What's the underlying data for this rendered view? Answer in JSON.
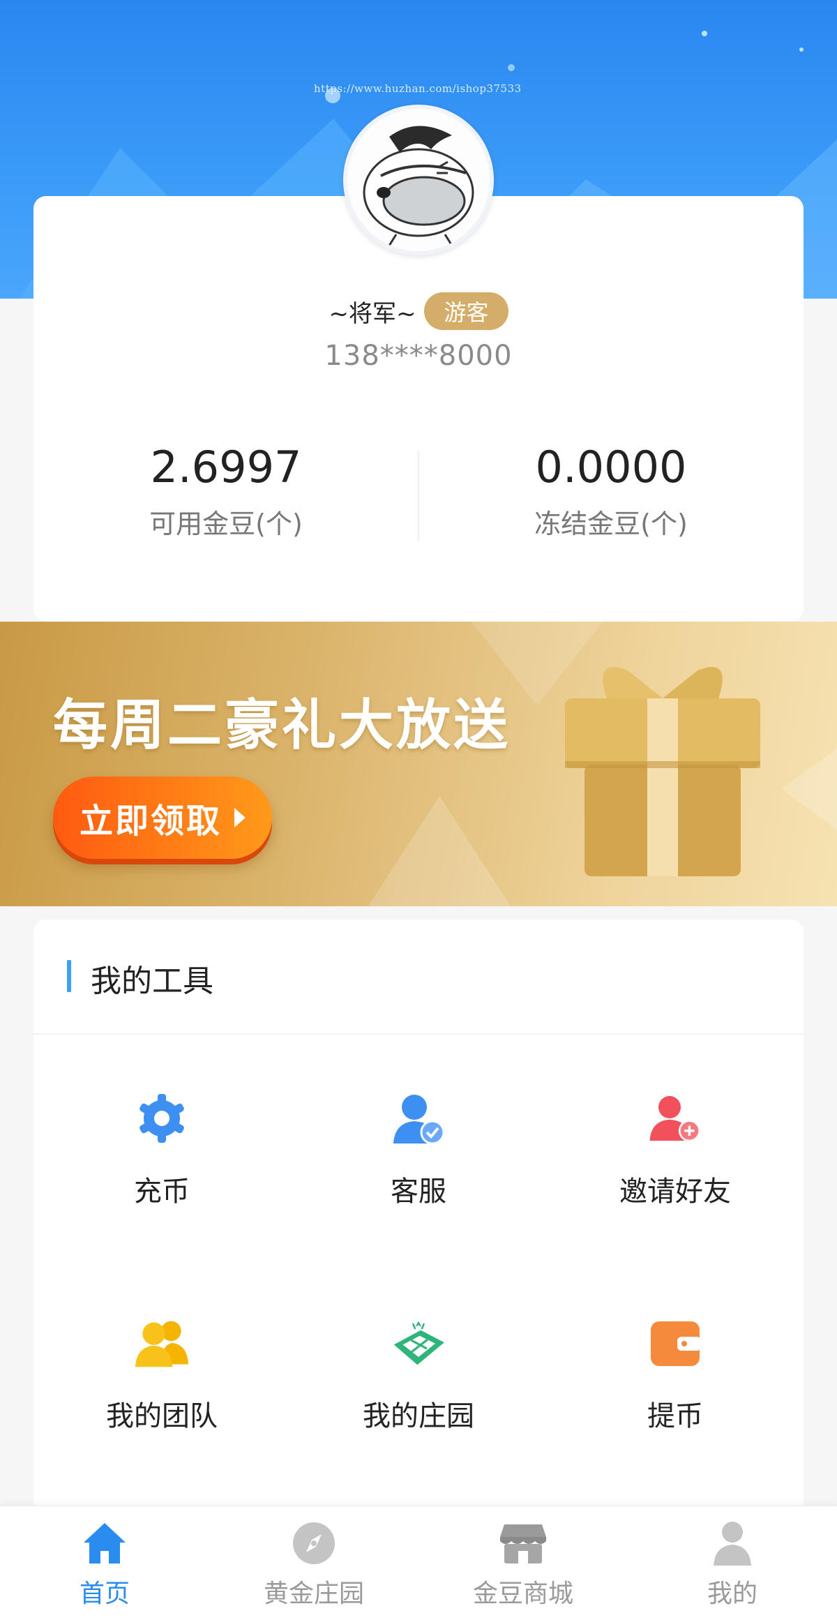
{
  "hero": {
    "url_watermark": "https://www.huzhan.com/ishop37533"
  },
  "profile": {
    "nickname": "~将军~",
    "role_badge": "游客",
    "phone": "138****8000",
    "stats": [
      {
        "value": "2.6997",
        "label": "可用金豆(个)"
      },
      {
        "value": "0.0000",
        "label": "冻结金豆(个)"
      }
    ]
  },
  "banner": {
    "title": "每周二豪礼大放送",
    "cta_label": "立即领取"
  },
  "tools": {
    "title": "我的工具",
    "accent_color": "#3aa2f6",
    "items": [
      {
        "label": "充币",
        "icon": "gear-icon",
        "color": "#3d8ff2"
      },
      {
        "label": "客服",
        "icon": "customer-service-icon",
        "color": "#3d8ff2"
      },
      {
        "label": "邀请好友",
        "icon": "add-user-icon",
        "color": "#f2505a"
      },
      {
        "label": "我的团队",
        "icon": "team-icon",
        "color": "#f7c21a"
      },
      {
        "label": "我的庄园",
        "icon": "farm-icon",
        "color": "#2fb57a"
      },
      {
        "label": "提币",
        "icon": "wallet-icon",
        "color": "#f58a3c"
      }
    ]
  },
  "tabbar": {
    "active_color": "#2b8cf0",
    "items": [
      {
        "label": "首页",
        "icon": "home-icon",
        "active": true
      },
      {
        "label": "黄金庄园",
        "icon": "compass-icon",
        "active": false
      },
      {
        "label": "金豆商城",
        "icon": "store-icon",
        "active": false
      },
      {
        "label": "我的",
        "icon": "user-icon",
        "active": false
      }
    ]
  }
}
